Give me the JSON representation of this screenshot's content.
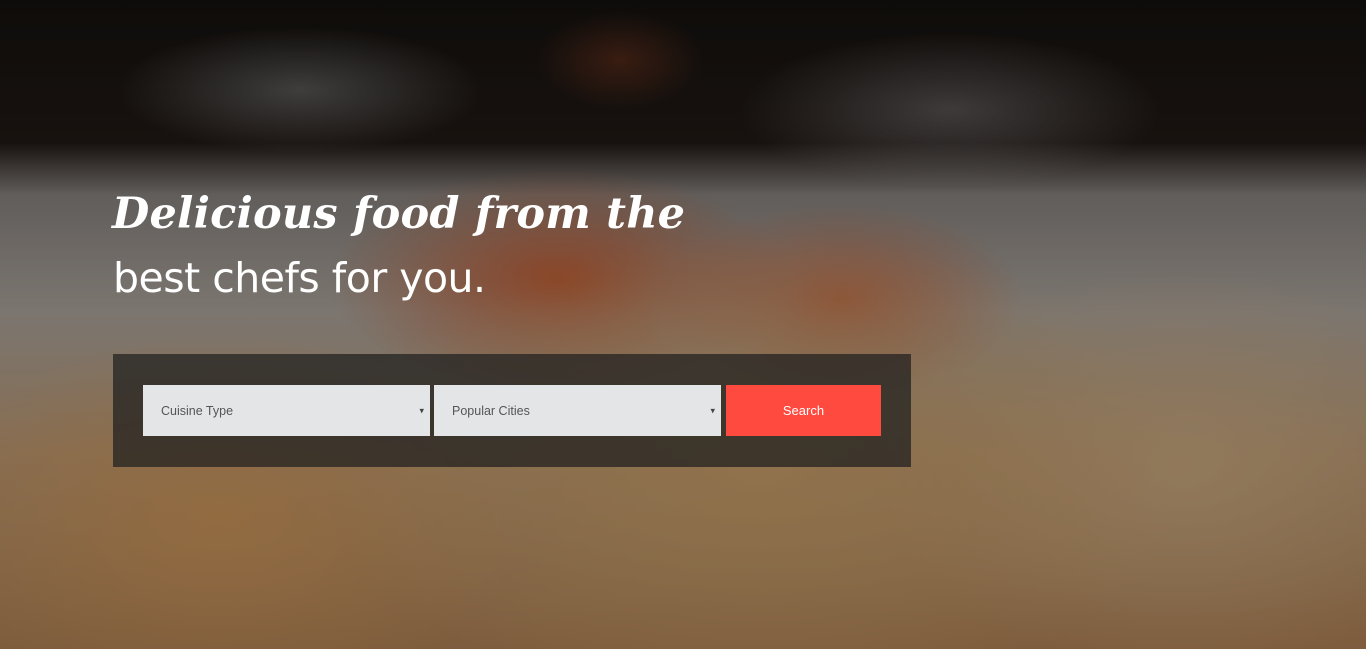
{
  "hero": {
    "headline": "Delicious food from the",
    "subline": "best chefs for you."
  },
  "search": {
    "cuisine_select": {
      "selected": "Cuisine Type"
    },
    "cities_select": {
      "selected": "Popular Cities"
    },
    "button_label": "Search"
  },
  "icons": {
    "dropdown_caret": "▾"
  },
  "colors": {
    "accent": "#ff4a3f",
    "select_bg": "#e3e5e7",
    "panel_bg": "rgba(30,30,30,0.72)"
  }
}
